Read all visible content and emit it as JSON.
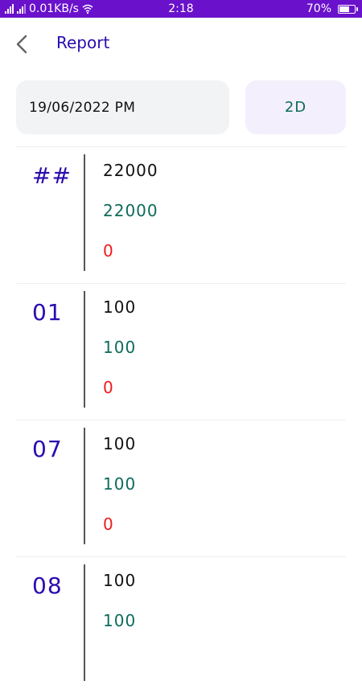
{
  "status_bar": {
    "network_speed": "0.01KB/s",
    "time": "2:18",
    "battery_percent": "70%",
    "battery_level": 0.7
  },
  "header": {
    "title": "Report"
  },
  "filters": {
    "date": "19/06/2022 PM",
    "type": "2D"
  },
  "colors": {
    "status_bar": "#6a11cb",
    "title": "#2a0bb0",
    "total": "#111111",
    "green": "#0e6b5b",
    "red": "#ee1c1c"
  },
  "rows": [
    {
      "label": "##",
      "value1": "22000",
      "value2": "22000",
      "value3": "0"
    },
    {
      "label": "01",
      "value1": "100",
      "value2": "100",
      "value3": "0"
    },
    {
      "label": "07",
      "value1": "100",
      "value2": "100",
      "value3": "0"
    },
    {
      "label": "08",
      "value1": "100",
      "value2": "100",
      "value3": ""
    }
  ]
}
